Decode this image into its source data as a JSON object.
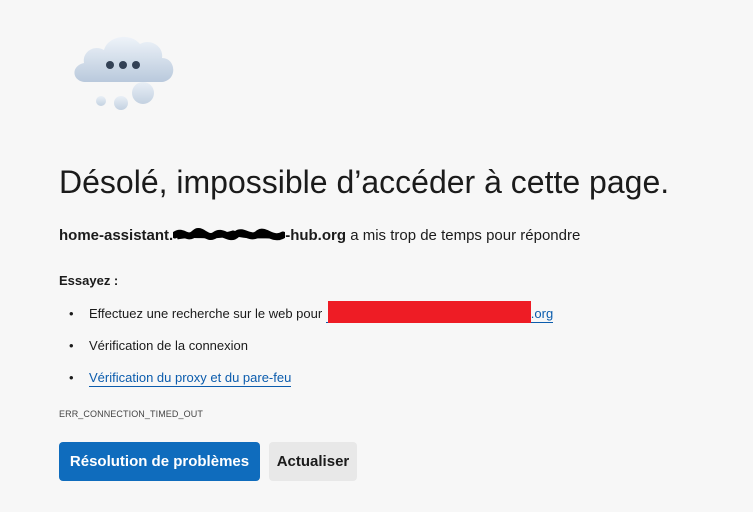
{
  "page": {
    "title": "Désolé, impossible d’accéder à cette page.",
    "host_prefix": "home-assistant.",
    "host_suffix": "-hub.org",
    "message_rest": " a mis trop de temps pour répondre",
    "try_label": "Essayez :",
    "suggestions": [
      {
        "text": "Effectuez une recherche sur le web pour ",
        "link_suffix": ".org"
      },
      {
        "text": "Vérification de la connexion"
      },
      {
        "link": "Vérification du proxy et du pare-feu"
      }
    ],
    "bullet": "•",
    "error_code": "ERR_CONNECTION_TIMED_OUT"
  },
  "buttons": {
    "troubleshoot": "Résolution de problèmes",
    "reload": "Actualiser"
  },
  "icons": {
    "illustration": "cloud-thinking-icon"
  },
  "colors": {
    "primary": "#0f6cbd",
    "link": "#0b5cad",
    "redaction": "#ee1c25",
    "background": "#f7f7f7"
  }
}
